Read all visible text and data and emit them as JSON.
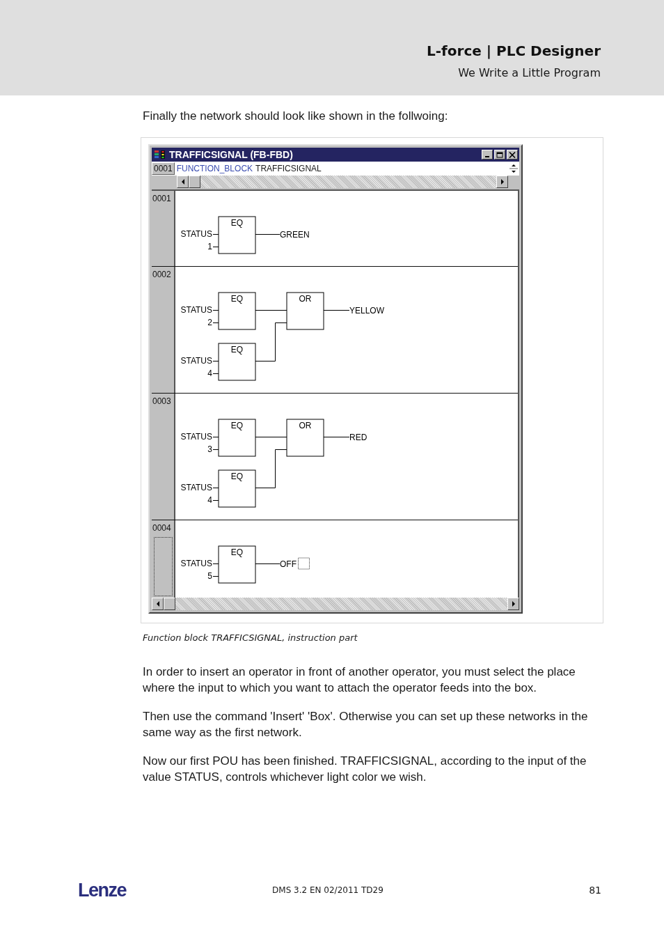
{
  "header": {
    "title": "L-force | PLC Designer",
    "subtitle": "We Write a Little Program"
  },
  "intro": "Finally the network should look like shown in the follwoing:",
  "window": {
    "title": "TRAFFICSIGNAL (FB-FBD)",
    "declaration": {
      "line_number": "0001",
      "keyword": "FUNCTION_BLOCK",
      "name": "TRAFFICSIGNAL"
    },
    "networks": [
      {
        "number": "0001",
        "selected": false,
        "kind": "single",
        "boxes": [
          {
            "op": "EQ",
            "inputs": [
              "STATUS",
              "1"
            ]
          }
        ],
        "output": "GREEN"
      },
      {
        "number": "0002",
        "selected": false,
        "kind": "or",
        "boxes": [
          {
            "op": "EQ",
            "inputs": [
              "STATUS",
              "2"
            ]
          },
          {
            "op": "EQ",
            "inputs": [
              "STATUS",
              "4"
            ]
          }
        ],
        "combiner": "OR",
        "output": "YELLOW"
      },
      {
        "number": "0003",
        "selected": false,
        "kind": "or",
        "boxes": [
          {
            "op": "EQ",
            "inputs": [
              "STATUS",
              "3"
            ]
          },
          {
            "op": "EQ",
            "inputs": [
              "STATUS",
              "4"
            ]
          }
        ],
        "combiner": "OR",
        "output": "RED"
      },
      {
        "number": "0004",
        "selected": true,
        "kind": "single",
        "boxes": [
          {
            "op": "EQ",
            "inputs": [
              "STATUS",
              "5"
            ]
          }
        ],
        "output": "OFF"
      }
    ]
  },
  "caption": "Function block TRAFFICSIGNAL, instruction part",
  "paragraphs": [
    "In order to insert an operator in front of another operator, you must select the place where the input to which you want to attach the operator feeds into the box.",
    "Then use the command 'Insert' 'Box'. Otherwise you can set up these networks in the same way as the first network.",
    "Now our first POU has been finished. TRAFFICSIGNAL, according to the input of the value STATUS, controls whichever light color we wish."
  ],
  "footer": {
    "logo": "Lenze",
    "document": "DMS 3.2 EN 02/2011 TD29",
    "page": "81"
  }
}
